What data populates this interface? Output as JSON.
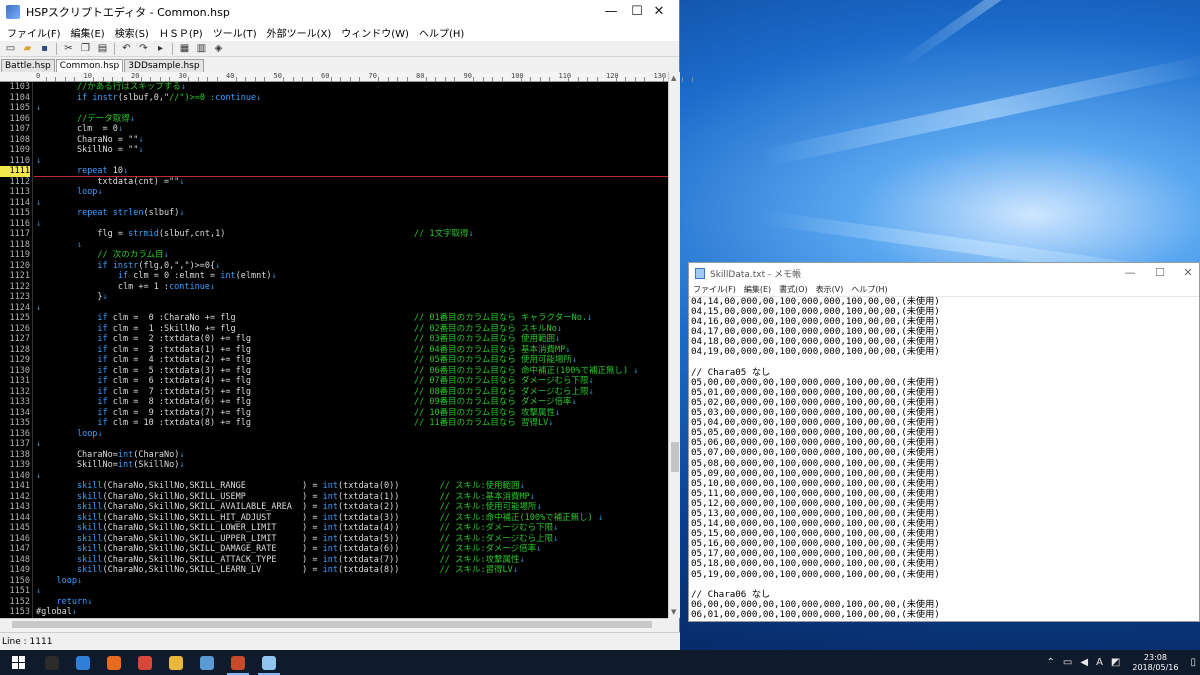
{
  "hsp_window": {
    "title": "HSPスクリプトエディタ - Common.hsp",
    "controls": {
      "minimize": "—",
      "maximize": "☐",
      "close": "✕"
    },
    "menu": [
      "ファイル(F)",
      "編集(E)",
      "検索(S)",
      "ＨＳＰ(P)",
      "ツール(T)",
      "外部ツール(X)",
      "ウィンドウ(W)",
      "ヘルプ(H)"
    ],
    "tabs": [
      "Battle.hsp",
      "Common.hsp",
      "3DDsample.hsp"
    ],
    "active_tab": 1,
    "ruler_ticks": [
      "0",
      "10",
      "20",
      "30",
      "40",
      "50",
      "60",
      "70",
      "80",
      "90",
      "100",
      "110",
      "120",
      "130"
    ],
    "current_line": "1111",
    "status": "Line : 1111",
    "lines": [
      {
        "n": "1103",
        "code": "        //かある行はスキップする↓",
        "comment": ""
      },
      {
        "n": "1104",
        "code": "        if instr(slbuf,0,\"//\")>=0 :continue↓",
        "comment": ""
      },
      {
        "n": "1105",
        "code": "↓",
        "comment": ""
      },
      {
        "n": "1106",
        "code": "        //データ取得↓",
        "comment": ""
      },
      {
        "n": "1107",
        "code": "        clm  = 0↓",
        "comment": ""
      },
      {
        "n": "1108",
        "code": "        CharaNo = \"\"↓",
        "comment": ""
      },
      {
        "n": "1109",
        "code": "        SkillNo = \"\"↓",
        "comment": ""
      },
      {
        "n": "1110",
        "code": "↓",
        "comment": ""
      },
      {
        "n": "1111",
        "code": "        repeat 10↓",
        "comment": ""
      },
      {
        "n": "1112",
        "code": "            txtdata(cnt) =\"\"↓",
        "comment": ""
      },
      {
        "n": "1113",
        "code": "        loop↓",
        "comment": ""
      },
      {
        "n": "1114",
        "code": "↓",
        "comment": ""
      },
      {
        "n": "1115",
        "code": "        repeat strlen(slbuf)↓",
        "comment": ""
      },
      {
        "n": "1116",
        "code": "↓",
        "comment": ""
      },
      {
        "n": "1117",
        "code": "            flg = strmid(slbuf,cnt,1)",
        "comment": "// 1文字取得↓"
      },
      {
        "n": "1118",
        "code": "        ↓",
        "comment": ""
      },
      {
        "n": "1119",
        "code": "            // 次のカラム目↓",
        "comment": ""
      },
      {
        "n": "1120",
        "code": "            if instr(flg,0,\",\")>=0{↓",
        "comment": ""
      },
      {
        "n": "1121",
        "code": "                if clm = 0 :elmnt = int(elmnt)↓",
        "comment": ""
      },
      {
        "n": "1122",
        "code": "                clm += 1 :continue↓",
        "comment": ""
      },
      {
        "n": "1123",
        "code": "            }↓",
        "comment": ""
      },
      {
        "n": "1124",
        "code": "↓",
        "comment": ""
      },
      {
        "n": "1125",
        "code": "            if clm =  0 :CharaNo += flg",
        "comment": "// 01番目のカラム目なら キャラクターNo.↓"
      },
      {
        "n": "1126",
        "code": "            if clm =  1 :SkillNo += flg",
        "comment": "// 02番目のカラム目なら スキルNo↓"
      },
      {
        "n": "1127",
        "code": "            if clm =  2 :txtdata(0) += flg",
        "comment": "// 03番目のカラム目なら 使用範囲↓"
      },
      {
        "n": "1128",
        "code": "            if clm =  3 :txtdata(1) += flg",
        "comment": "// 04番目のカラム目なら 基本消費MP↓"
      },
      {
        "n": "1129",
        "code": "            if clm =  4 :txtdata(2) += flg",
        "comment": "// 05番目のカラム目なら 使用可能場所↓"
      },
      {
        "n": "1130",
        "code": "            if clm =  5 :txtdata(3) += flg",
        "comment": "// 06番目のカラム目なら 命中補正(100%で補正無し) ↓"
      },
      {
        "n": "1131",
        "code": "            if clm =  6 :txtdata(4) += flg",
        "comment": "// 07番目のカラム目なら ダメージむら下限↓"
      },
      {
        "n": "1132",
        "code": "            if clm =  7 :txtdata(5) += flg",
        "comment": "// 08番目のカラム目なら ダメージむら上限↓"
      },
      {
        "n": "1133",
        "code": "            if clm =  8 :txtdata(6) += flg",
        "comment": "// 09番目のカラム目なら ダメージ倍率↓"
      },
      {
        "n": "1134",
        "code": "            if clm =  9 :txtdata(7) += flg",
        "comment": "// 10番目のカラム目なら 攻撃属性↓"
      },
      {
        "n": "1135",
        "code": "            if clm = 10 :txtdata(8) += flg",
        "comment": "// 11番目のカラム目なら 習得LV↓"
      },
      {
        "n": "1136",
        "code": "        loop↓",
        "comment": ""
      },
      {
        "n": "1137",
        "code": "↓",
        "comment": ""
      },
      {
        "n": "1138",
        "code": "        CharaNo=int(CharaNo)↓",
        "comment": ""
      },
      {
        "n": "1139",
        "code": "        SkillNo=int(SkillNo)↓",
        "comment": ""
      },
      {
        "n": "1140",
        "code": "↓",
        "comment": ""
      },
      {
        "n": "1141",
        "code": "        skill(CharaNo,SkillNo,SKILL_RANGE           ) = int(txtdata(0))",
        "comment": "     // スキル:使用範囲↓"
      },
      {
        "n": "1142",
        "code": "        skill(CharaNo,SkillNo,SKILL_USEMP           ) = int(txtdata(1))",
        "comment": "     // スキル:基本消費MP↓"
      },
      {
        "n": "1143",
        "code": "        skill(CharaNo,SkillNo,SKILL_AVAILABLE_AREA  ) = int(txtdata(2))",
        "comment": "     // スキル:使用可能場所↓"
      },
      {
        "n": "1144",
        "code": "        skill(CharaNo,SkillNo,SKILL_HIT_ADJUST      ) = int(txtdata(3))",
        "comment": "     // スキル:命中補正(100%で補正無し) ↓"
      },
      {
        "n": "1145",
        "code": "        skill(CharaNo,SkillNo,SKILL_LOWER_LIMIT     ) = int(txtdata(4))",
        "comment": "     // スキル:ダメージむら下限↓"
      },
      {
        "n": "1146",
        "code": "        skill(CharaNo,SkillNo,SKILL_UPPER_LIMIT     ) = int(txtdata(5))",
        "comment": "     // スキル:ダメージむら上限↓"
      },
      {
        "n": "1147",
        "code": "        skill(CharaNo,SkillNo,SKILL_DAMAGE_RATE     ) = int(txtdata(6))",
        "comment": "     // スキル:ダメージ倍率↓"
      },
      {
        "n": "1148",
        "code": "        skill(CharaNo,SkillNo,SKILL_ATTACK_TYPE     ) = int(txtdata(7))",
        "comment": "     // スキル:攻撃属性↓"
      },
      {
        "n": "1149",
        "code": "        skill(CharaNo,SkillNo,SKILL_LEARN_LV        ) = int(txtdata(8))",
        "comment": "     // スキル:習得LV↓"
      },
      {
        "n": "1150",
        "code": "    loop↓",
        "comment": ""
      },
      {
        "n": "1151",
        "code": "↓",
        "comment": ""
      },
      {
        "n": "1152",
        "code": "    return↓",
        "comment": ""
      },
      {
        "n": "1153",
        "code": "#global↓",
        "comment": ""
      }
    ]
  },
  "notepad": {
    "title": "SkillData.txt - メモ帳",
    "controls": {
      "minimize": "—",
      "maximize": "☐",
      "close": "✕"
    },
    "menu": [
      "ファイル(F)",
      "編集(E)",
      "書式(O)",
      "表示(V)",
      "ヘルプ(H)"
    ],
    "lines": [
      "04,14,00,000,00,100,000,000,100,00,00,(未使用)",
      "04,15,00,000,00,100,000,000,100,00,00,(未使用)",
      "04,16,00,000,00,100,000,000,100,00,00,(未使用)",
      "04,17,00,000,00,100,000,000,100,00,00,(未使用)",
      "04,18,00,000,00,100,000,000,100,00,00,(未使用)",
      "04,19,00,000,00,100,000,000,100,00,00,(未使用)",
      "",
      "// Chara05 なし",
      "05,00,00,000,00,100,000,000,100,00,00,(未使用)",
      "05,01,00,000,00,100,000,000,100,00,00,(未使用)",
      "05,02,00,000,00,100,000,000,100,00,00,(未使用)",
      "05,03,00,000,00,100,000,000,100,00,00,(未使用)",
      "05,04,00,000,00,100,000,000,100,00,00,(未使用)",
      "05,05,00,000,00,100,000,000,100,00,00,(未使用)",
      "05,06,00,000,00,100,000,000,100,00,00,(未使用)",
      "05,07,00,000,00,100,000,000,100,00,00,(未使用)",
      "05,08,00,000,00,100,000,000,100,00,00,(未使用)",
      "05,09,00,000,00,100,000,000,100,00,00,(未使用)",
      "05,10,00,000,00,100,000,000,100,00,00,(未使用)",
      "05,11,00,000,00,100,000,000,100,00,00,(未使用)",
      "05,12,00,000,00,100,000,000,100,00,00,(未使用)",
      "05,13,00,000,00,100,000,000,100,00,00,(未使用)",
      "05,14,00,000,00,100,000,000,100,00,00,(未使用)",
      "05,15,00,000,00,100,000,000,100,00,00,(未使用)",
      "05,16,00,000,00,100,000,000,100,00,00,(未使用)",
      "05,17,00,000,00,100,000,000,100,00,00,(未使用)",
      "05,18,00,000,00,100,000,000,100,00,00,(未使用)",
      "05,19,00,000,00,100,000,000,100,00,00,(未使用)",
      "",
      "// Chara06 なし",
      "06,00,00,000,00,100,000,000,100,00,00,(未使用)",
      "06,01,00,000,00,100,000,000,100,00,00,(未使用)"
    ]
  },
  "taskbar": {
    "apps": [
      {
        "icon": "task-view-icon",
        "color": "#2b2b2b"
      },
      {
        "icon": "edge-browser-icon",
        "color": "#2f7fd8"
      },
      {
        "icon": "firefox-icon",
        "color": "#e86a1f"
      },
      {
        "icon": "chrome-icon",
        "color": "#d9463a"
      },
      {
        "icon": "file-explorer-icon",
        "color": "#e8b83b"
      },
      {
        "icon": "chat-app-icon",
        "color": "#5b9bd5"
      },
      {
        "icon": "hsp-editor-icon",
        "color": "#c74a2a"
      },
      {
        "icon": "notepad-icon",
        "color": "#8fc5ee"
      }
    ],
    "ime": "A",
    "time": "23:08",
    "date": "2018/05/16"
  }
}
